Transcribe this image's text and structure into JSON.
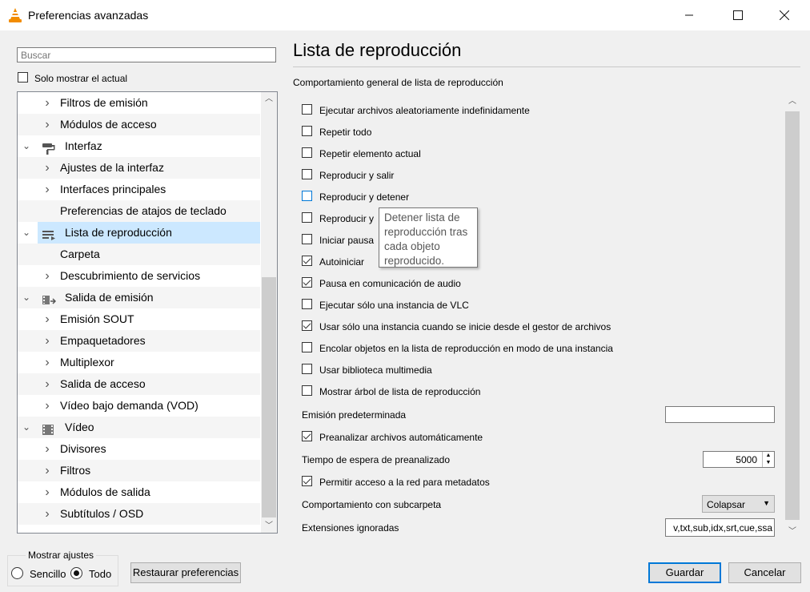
{
  "window": {
    "title": "Preferencias avanzadas"
  },
  "search": {
    "placeholder": "Buscar"
  },
  "only_current": {
    "label": "Solo mostrar el actual",
    "checked": false
  },
  "tree": {
    "items": [
      {
        "label": "Filtros de emisión",
        "level": 2,
        "expander": "collapsed"
      },
      {
        "label": "Módulos de acceso",
        "level": 2,
        "expander": "collapsed"
      },
      {
        "label": "Interfaz",
        "level": 1,
        "expander": "expanded",
        "icon": "paint-roller-icon"
      },
      {
        "label": "Ajustes de la interfaz",
        "level": 2,
        "expander": "collapsed"
      },
      {
        "label": "Interfaces principales",
        "level": 2,
        "expander": "collapsed"
      },
      {
        "label": "Preferencias de atajos de teclado",
        "level": 2,
        "expander": "none"
      },
      {
        "label": "Lista de reproducción",
        "level": 1,
        "expander": "expanded",
        "icon": "playlist-icon",
        "selected": true
      },
      {
        "label": "Carpeta",
        "level": 2,
        "expander": "none"
      },
      {
        "label": "Descubrimiento de servicios",
        "level": 2,
        "expander": "collapsed"
      },
      {
        "label": "Salida de emisión",
        "level": 1,
        "expander": "expanded",
        "icon": "stream-output-icon"
      },
      {
        "label": "Emisión SOUT",
        "level": 2,
        "expander": "collapsed"
      },
      {
        "label": "Empaquetadores",
        "level": 2,
        "expander": "collapsed"
      },
      {
        "label": "Multiplexor",
        "level": 2,
        "expander": "collapsed"
      },
      {
        "label": "Salida de acceso",
        "level": 2,
        "expander": "collapsed"
      },
      {
        "label": "Vídeo bajo demanda (VOD)",
        "level": 2,
        "expander": "collapsed"
      },
      {
        "label": "Vídeo",
        "level": 1,
        "expander": "expanded",
        "icon": "video-icon"
      },
      {
        "label": "Divisores",
        "level": 2,
        "expander": "collapsed"
      },
      {
        "label": "Filtros",
        "level": 2,
        "expander": "collapsed"
      },
      {
        "label": "Módulos de salida",
        "level": 2,
        "expander": "collapsed"
      },
      {
        "label": "Subtítulos / OSD",
        "level": 2,
        "expander": "collapsed"
      }
    ]
  },
  "panel": {
    "title": "Lista de reproducción",
    "subtitle": "Comportamiento general de lista de reproducción",
    "options": [
      {
        "label": "Ejecutar archivos aleatoriamente indefinidamente",
        "checked": false
      },
      {
        "label": "Repetir todo",
        "checked": false
      },
      {
        "label": "Repetir elemento actual",
        "checked": false
      },
      {
        "label": "Reproducir y salir",
        "checked": false
      },
      {
        "label": "Reproducir y detener",
        "checked": false,
        "hover": true
      },
      {
        "label": "Reproducir y",
        "checked": false
      },
      {
        "label": "Iniciar pausa",
        "checked": false
      },
      {
        "label": "Autoiniciar",
        "checked": true
      },
      {
        "label": "Pausa en comunicación de audio",
        "checked": true
      },
      {
        "label": "Ejecutar sólo una instancia de VLC",
        "checked": false
      },
      {
        "label": "Usar sólo una instancia cuando se inicie desde el gestor de archivos",
        "checked": true
      },
      {
        "label": "Encolar objetos en la lista de reproducción en modo de una instancia",
        "checked": false
      },
      {
        "label": "Usar biblioteca multimedia",
        "checked": false
      },
      {
        "label": "Mostrar árbol de lista de reproducción",
        "checked": false
      }
    ],
    "default_stream": {
      "label": "Emisión predeterminada",
      "value": ""
    },
    "preparse": {
      "label": "Preanalizar archivos automáticamente",
      "checked": true
    },
    "preparse_timeout": {
      "label": "Tiempo de espera de preanalizado",
      "value": "5000"
    },
    "network_meta": {
      "label": "Permitir acceso a la red para metadatos",
      "checked": true
    },
    "subdir": {
      "label": "Comportamiento con subcarpeta",
      "value": "Colapsar"
    },
    "ignored_ext": {
      "label": "Extensiones ignoradas",
      "value": "v,txt,sub,idx,srt,cue,ssa"
    },
    "tooltip": {
      "lines": [
        "Detener lista de",
        "reproducción tras",
        "cada objeto",
        "reproducido."
      ]
    }
  },
  "bottom": {
    "show_settings_label": "Mostrar ajustes",
    "simple_label": "Sencillo",
    "all_label": "Todo",
    "selected_mode": "Todo",
    "reset_label": "Restaurar preferencias",
    "save_label": "Guardar",
    "cancel_label": "Cancelar"
  },
  "colors": {
    "selection": "#cce8ff",
    "accent": "#0078d7",
    "vlc_orange": "#f28c00"
  }
}
